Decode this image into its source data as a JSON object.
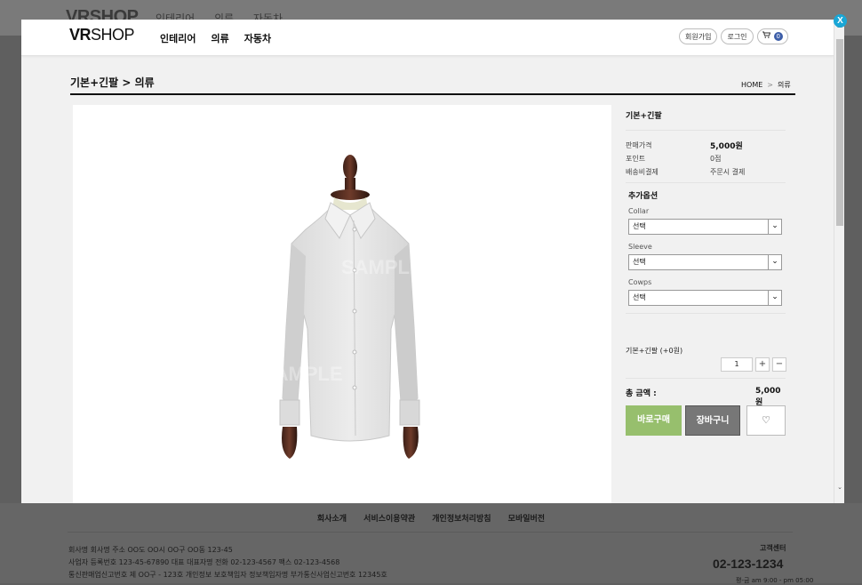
{
  "background": {
    "logo": "VRSHOP",
    "nav": [
      "인테리어",
      "의류",
      "자동차"
    ],
    "footer_links": [
      "회사소개",
      "서비스이용약관",
      "개인정보처리방침",
      "모바일버전"
    ],
    "company_line1": "회사명 회사명 주소 OO도 OO시 OO구 OO동 123-45",
    "company_line2": "사업자 등록번호 123-45-67890 대표 대표자명 전화 02-123-4567 팩스 02-123-4568",
    "company_line3": "통신판매업신고번호 제 OO구 - 123호 개인정보 보호책임자 정보책임자명 부가통신사업신고번호 12345호",
    "cs_title": "고객센터",
    "cs_phone": "02-123-1234",
    "cs_hours": "평-금 am 9:00 - pm 05:00"
  },
  "header": {
    "logo_bold": "VR",
    "logo_rest": "SHOP",
    "nav": [
      "인테리어",
      "의류",
      "자동차"
    ],
    "join_label": "회원가입",
    "login_label": "로그인",
    "cart_count": "0"
  },
  "page": {
    "title": "기본+긴팔 > 의류",
    "breadcrumb_home": "HOME",
    "breadcrumb_sep": ">",
    "breadcrumb_current": "의류",
    "watermark": "SAMPLE"
  },
  "product": {
    "name": "기본+긴팔",
    "price_label": "판매가격",
    "price_value": "5,000원",
    "point_label": "포인트",
    "point_value": "0점",
    "shipping_label": "배송비결제",
    "shipping_value": "주문시 결제",
    "options_title": "추가옵션",
    "options": [
      {
        "label": "Collar",
        "value": "선택"
      },
      {
        "label": "Sleeve",
        "value": "선택"
      },
      {
        "label": "Cowps",
        "value": "선택"
      }
    ],
    "qty_item": "기본+긴팔 (+0원)",
    "qty_value": "1",
    "total_label": "총 금액 :",
    "total_value": "5,000원",
    "buy_label": "바로구매",
    "cart_label": "장바구니"
  },
  "close_label": "X"
}
